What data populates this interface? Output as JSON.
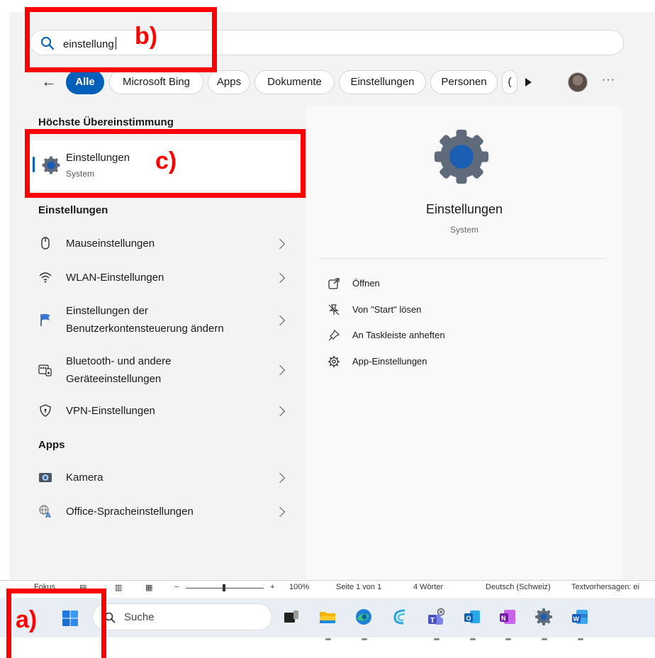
{
  "search": {
    "query": "einstellung",
    "icon": "search-icon"
  },
  "filters": {
    "back_icon": "back-arrow-icon",
    "tabs": [
      "Alle",
      "Microsoft Bing",
      "Apps",
      "Dokumente",
      "Einstellungen",
      "Personen",
      "("
    ],
    "active_tab": "Alle",
    "more_icon": "more-icon"
  },
  "results": {
    "best_match_heading": "Höchste Übereinstimmung",
    "best_match": {
      "title": "Einstellungen",
      "subtitle": "System",
      "icon": "settings-gear-icon"
    },
    "settings_heading": "Einstellungen",
    "settings_items": [
      {
        "label": "Mauseinstellungen",
        "icon": "mouse-icon"
      },
      {
        "label": "WLAN-Einstellungen",
        "icon": "wifi-icon"
      },
      {
        "label": "Einstellungen der",
        "label2": "Benutzerkontensteuerung ändern",
        "icon": "uac-flag-icon"
      },
      {
        "label": "Bluetooth- und andere",
        "label2": "Geräteeinstellungen",
        "icon": "devices-icon"
      },
      {
        "label": "VPN-Einstellungen",
        "icon": "vpn-shield-icon"
      }
    ],
    "apps_heading": "Apps",
    "apps_items": [
      {
        "label": "Kamera",
        "icon": "camera-icon"
      },
      {
        "label": "Office-Spracheinstellungen",
        "icon": "language-icon"
      }
    ]
  },
  "detail": {
    "title": "Einstellungen",
    "subtitle": "System",
    "actions": [
      {
        "label": "Öffnen",
        "icon": "open-icon"
      },
      {
        "label": "Von \"Start\" lösen",
        "icon": "unpin-icon"
      },
      {
        "label": "An Taskleiste anheften",
        "icon": "pin-icon"
      },
      {
        "label": "App-Einstellungen",
        "icon": "gear-icon"
      }
    ]
  },
  "statusbar": {
    "focus": "Fokus",
    "zoom": "100%",
    "page": "Seite 1 von 1",
    "words": "4 Wörter",
    "language": "Deutsch (Schweiz)",
    "predictions": "Textvorhersagen: ei"
  },
  "taskbar": {
    "search_label": "Suche",
    "apps": [
      "task-view-icon",
      "file-explorer-icon",
      "edge-icon",
      "cortana-icon",
      "teams-icon",
      "outlook-icon",
      "onenote-icon",
      "settings-icon",
      "word-icon"
    ]
  },
  "annotations": {
    "a": "a)",
    "b": "b)",
    "c": "c)",
    "color": "#ff0000"
  },
  "colors": {
    "accent": "#005fb8",
    "annotation": "#ff0000"
  }
}
